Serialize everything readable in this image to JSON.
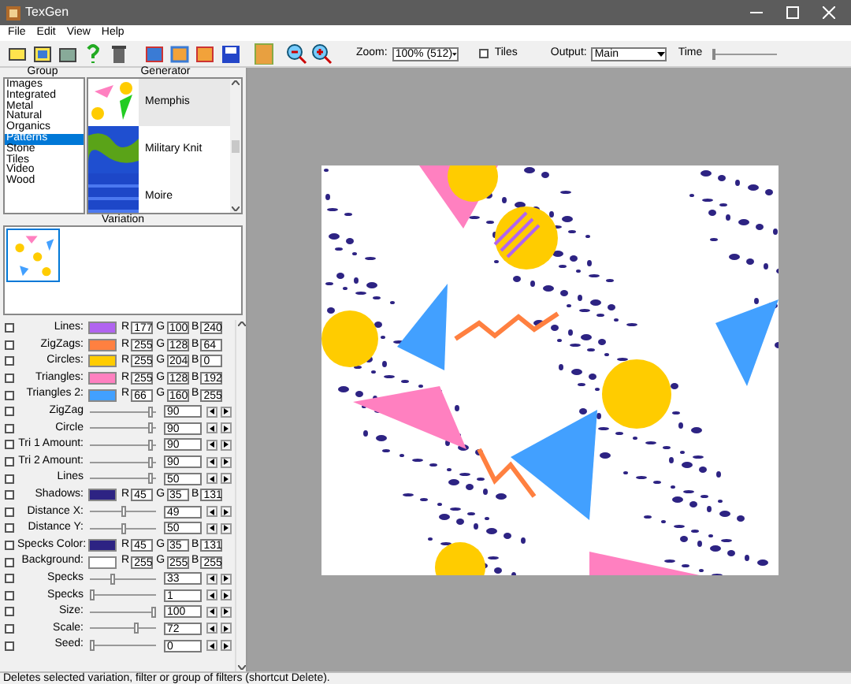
{
  "window": {
    "title": "TexGen"
  },
  "menu": [
    "File",
    "Edit",
    "View",
    "Help"
  ],
  "toolbar": {
    "zoom_label": "Zoom:",
    "zoom_value": "100% (512)",
    "tiles_label": "Tiles",
    "tiles_checked": false,
    "output_label": "Output:",
    "output_value": "Main",
    "time_slider": {
      "label": "Time",
      "level": 0.02
    }
  },
  "group": {
    "header": "Group",
    "items": [
      {
        "label": "Images",
        "selected": false
      },
      {
        "label": "Integrated",
        "selected": false
      },
      {
        "label": "Metal",
        "selected": false
      },
      {
        "label": "Natural",
        "selected": false
      },
      {
        "label": "Organics",
        "selected": false
      },
      {
        "label": "Patterns",
        "selected": true
      },
      {
        "label": "Stone",
        "selected": false
      },
      {
        "label": "Tiles",
        "selected": false
      },
      {
        "label": "Video",
        "selected": false
      },
      {
        "label": "Wood",
        "selected": false
      }
    ]
  },
  "generator": {
    "header": "Generator",
    "items": [
      {
        "label": "Memphis",
        "kind": "memphis",
        "selected": true
      },
      {
        "label": "Military Knit",
        "kind": "knit",
        "selected": false
      },
      {
        "label": "Moire",
        "kind": "moire",
        "selected": false
      }
    ]
  },
  "variation": {
    "header": "Variation"
  },
  "params": [
    {
      "kind": "color",
      "label": "Lines:",
      "checked": false,
      "color": "#b164f0",
      "channels": [
        {
          "label": "R",
          "value": "177"
        },
        {
          "label": "G",
          "value": "100"
        },
        {
          "label": "B",
          "value": "240"
        }
      ]
    },
    {
      "kind": "color",
      "label": "ZigZags:",
      "checked": false,
      "color": "#ff8040",
      "channels": [
        {
          "label": "R",
          "value": "255"
        },
        {
          "label": "G",
          "value": "128"
        },
        {
          "label": "B",
          "value": "64"
        }
      ]
    },
    {
      "kind": "color",
      "label": "Circles:",
      "checked": false,
      "color": "#ffcc00",
      "channels": [
        {
          "label": "R",
          "value": "255"
        },
        {
          "label": "G",
          "value": "204"
        },
        {
          "label": "B",
          "value": "0"
        }
      ]
    },
    {
      "kind": "color",
      "label": "Triangles:",
      "checked": false,
      "color": "#ff80c0",
      "channels": [
        {
          "label": "R",
          "value": "255"
        },
        {
          "label": "G",
          "value": "128"
        },
        {
          "label": "B",
          "value": "192"
        }
      ]
    },
    {
      "kind": "color",
      "label": "Triangles 2:",
      "checked": false,
      "color": "#42a0ff",
      "channels": [
        {
          "label": "R",
          "value": "66"
        },
        {
          "label": "G",
          "value": "160"
        },
        {
          "label": "B",
          "value": "255"
        }
      ]
    },
    {
      "kind": "slider",
      "label": "ZigZag",
      "checked": false,
      "level": 0.95,
      "value": "90"
    },
    {
      "kind": "slider",
      "label": "Circle",
      "checked": false,
      "level": 0.95,
      "value": "90"
    },
    {
      "kind": "slider",
      "label": "Tri 1 Amount:",
      "checked": false,
      "level": 0.95,
      "value": "90"
    },
    {
      "kind": "slider",
      "label": "Tri 2 Amount:",
      "checked": false,
      "level": 0.95,
      "value": "90"
    },
    {
      "kind": "slider",
      "label": "Lines",
      "checked": false,
      "level": 0.95,
      "value": "50"
    },
    {
      "kind": "color",
      "label": "Shadows:",
      "checked": false,
      "color": "#2d2383",
      "channels": [
        {
          "label": "R",
          "value": "45"
        },
        {
          "label": "G",
          "value": "35"
        },
        {
          "label": "B",
          "value": "131"
        }
      ]
    },
    {
      "kind": "slider",
      "label": "Distance X:",
      "checked": false,
      "level": 0.5,
      "value": "49"
    },
    {
      "kind": "slider",
      "label": "Distance Y:",
      "checked": false,
      "level": 0.5,
      "value": "50"
    },
    {
      "kind": "color",
      "label": "Specks Color:",
      "checked": false,
      "color": "#2d2383",
      "channels": [
        {
          "label": "R",
          "value": "45"
        },
        {
          "label": "G",
          "value": "35"
        },
        {
          "label": "B",
          "value": "131"
        }
      ]
    },
    {
      "kind": "color",
      "label": "Background:",
      "checked": false,
      "color": "#ffffff",
      "channels": [
        {
          "label": "R",
          "value": "255"
        },
        {
          "label": "G",
          "value": "255"
        },
        {
          "label": "B",
          "value": "255"
        }
      ]
    },
    {
      "kind": "slider",
      "label": "Specks",
      "checked": false,
      "level": 0.33,
      "value": "33"
    },
    {
      "kind": "slider",
      "label": "Specks",
      "checked": false,
      "level": 0.01,
      "value": "1"
    },
    {
      "kind": "slider",
      "label": "Size:",
      "checked": false,
      "level": 1,
      "value": "100"
    },
    {
      "kind": "slider",
      "label": "Scale:",
      "checked": false,
      "level": 0.72,
      "value": "72"
    },
    {
      "kind": "slider",
      "label": "Seed:",
      "checked": false,
      "level": 0,
      "value": "0"
    }
  ],
  "status_bar": "Deletes selected variation, filter or group of filters (shortcut Delete)."
}
